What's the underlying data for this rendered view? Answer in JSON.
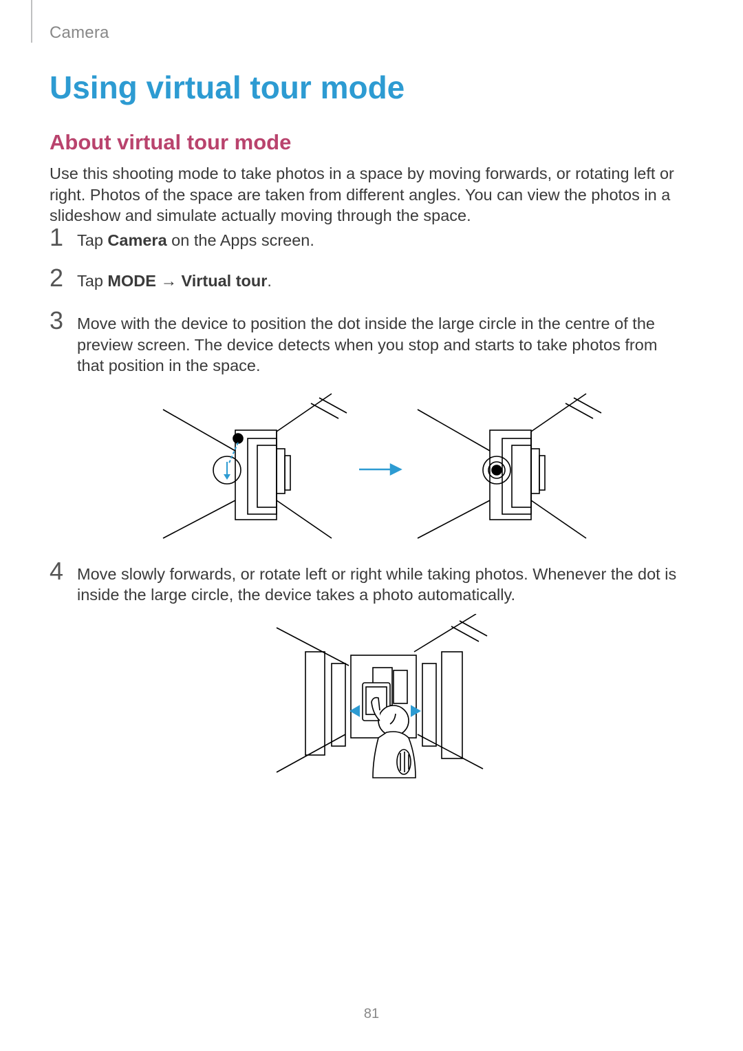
{
  "header": {
    "section": "Camera"
  },
  "title": "Using virtual tour mode",
  "subtitle": "About virtual tour mode",
  "intro": "Use this shooting mode to take photos in a space by moving forwards, or rotating left or right. Photos of the space are taken from different angles. You can view the photos in a slideshow and simulate actually moving through the space.",
  "steps": {
    "1": {
      "num": "1",
      "pre": "Tap ",
      "bold1": "Camera",
      "post": " on the Apps screen."
    },
    "2": {
      "num": "2",
      "pre": "Tap ",
      "bold1": "MODE",
      "arrow": " → ",
      "bold2": "Virtual tour",
      "post": "."
    },
    "3": {
      "num": "3",
      "text": "Move with the device to position the dot inside the large circle in the centre of the preview screen. The device detects when you stop and starts to take photos from that position in the space."
    },
    "4": {
      "num": "4",
      "text": "Move slowly forwards, or rotate left or right while taking photos. Whenever the dot is inside the large circle, the device takes a photo automatically."
    }
  },
  "pageNumber": "81"
}
